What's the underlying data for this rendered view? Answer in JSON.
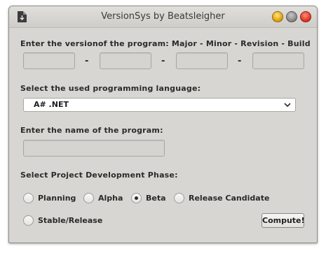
{
  "window": {
    "title": "VersionSys by Beatsleigher",
    "controls": [
      "minimize",
      "maximize",
      "close"
    ]
  },
  "version": {
    "label": "Enter the versionof the program: Major - Minor - Revision - Build",
    "fields": [
      {
        "name": "major",
        "value": ""
      },
      {
        "name": "minor",
        "value": ""
      },
      {
        "name": "revision",
        "value": ""
      },
      {
        "name": "build",
        "value": ""
      }
    ],
    "separator": "-"
  },
  "language": {
    "label": "Select the used programming language:",
    "selected": "A# .NET"
  },
  "program_name": {
    "label": "Enter the name of the program:",
    "value": ""
  },
  "phase": {
    "label": "Select Project Development Phase:",
    "options": [
      "Planning",
      "Alpha",
      "Beta",
      "Release Candidate",
      "Stable/Release"
    ],
    "selected": "Beta"
  },
  "actions": {
    "compute_label": "Compute!"
  }
}
